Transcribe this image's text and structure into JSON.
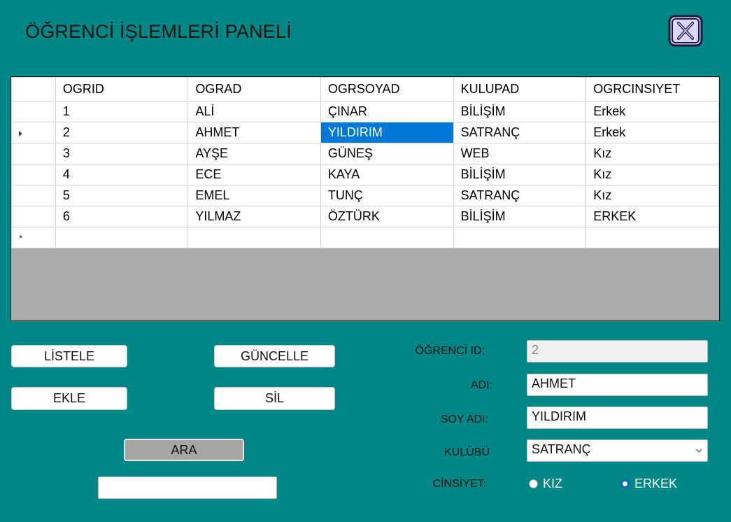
{
  "window": {
    "title": "ÖĞRENCİ İŞLEMLERİ PANELİ",
    "close_icon": "close-x-icon"
  },
  "grid": {
    "columns": [
      "OGRID",
      "OGRAD",
      "OGRSOYAD",
      "KULUPAD",
      "OGRCINSIYET"
    ],
    "rows": [
      [
        "1",
        "ALİ",
        "ÇINAR",
        "BİLİŞİM",
        "Erkek"
      ],
      [
        "2",
        "AHMET",
        "YILDIRIM",
        "SATRANÇ",
        "Erkek"
      ],
      [
        "3",
        "AYŞE",
        "GÜNEŞ",
        "WEB",
        "Kız"
      ],
      [
        "4",
        "ECE",
        "KAYA",
        "BİLİŞİM",
        "Kız"
      ],
      [
        "5",
        "EMEL",
        "TUNÇ",
        "SATRANÇ",
        "Kız"
      ],
      [
        "6",
        "YILMAZ",
        "ÖZTÜRK",
        "BİLİŞİM",
        "ERKEK"
      ]
    ],
    "current_row": 1,
    "selected_cell": {
      "row": 1,
      "col": 2
    },
    "new_row_marker": "*",
    "selection_color": "#0078d7"
  },
  "buttons": {
    "listele": "LİSTELE",
    "guncelle": "GÜNCELLE",
    "ekle": "EKLE",
    "sil": "SİL",
    "ara": "ARA"
  },
  "search": {
    "value": ""
  },
  "form": {
    "id_label": "ÖĞRENCİ ID:",
    "id_value": "2",
    "ad_label": "ADI:",
    "ad_value": "AHMET",
    "soyad_label": "SOY ADI:",
    "soyad_value": "YILDIRIM",
    "kulup_label": "KULÜBÜ",
    "kulup_value": "SATRANÇ",
    "cinsiyet_label": "CİNSİYET:",
    "radio_kiz": "KIZ",
    "radio_erkek": "ERKEK",
    "selected_gender": "ERKEK"
  },
  "colors": {
    "background": "#018786",
    "grid_empty": "#ababab"
  }
}
